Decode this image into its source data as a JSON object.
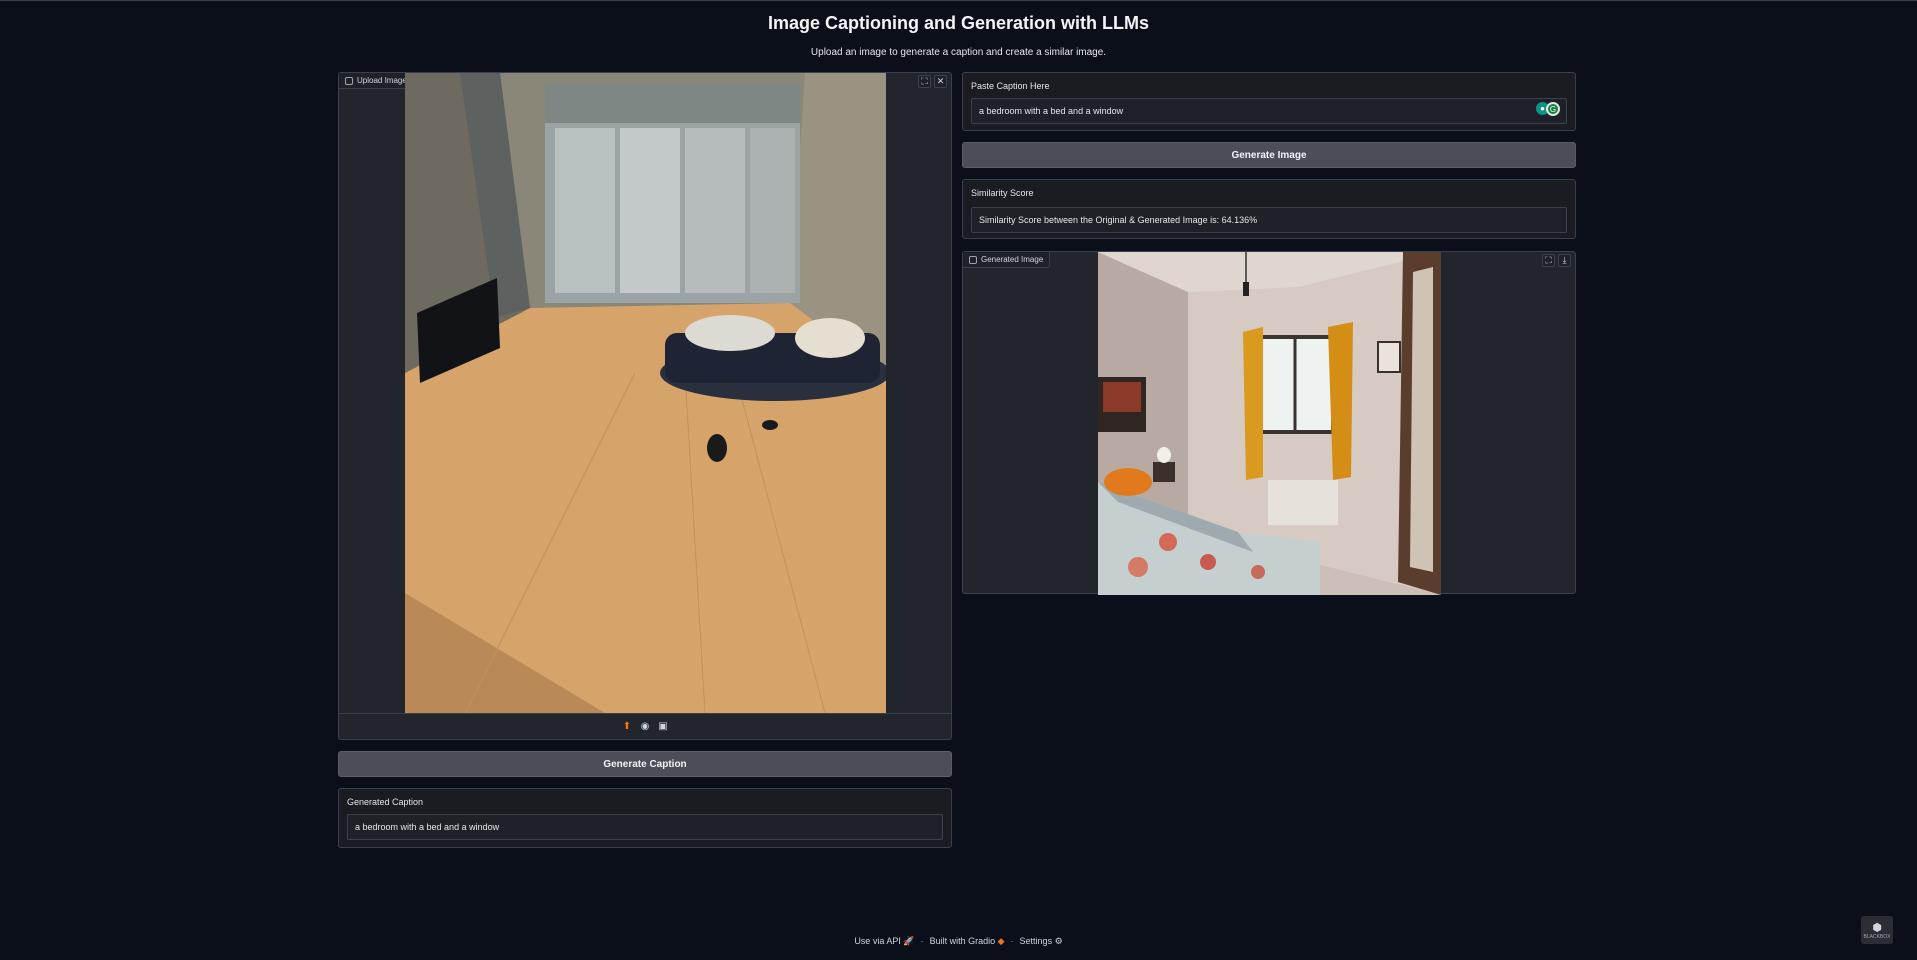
{
  "header": {
    "title": "Image Captioning and Generation with LLMs",
    "subtitle": "Upload an image to generate a caption and create a similar image."
  },
  "upload_panel": {
    "label": "Upload Image",
    "image_alt": "photo of a room with a wooden floor, an inflatable mattress, a TV and a window with blinds",
    "toolbar_icons": [
      "upload-icon",
      "webcam-icon",
      "clipboard-icon"
    ]
  },
  "generate_caption_button": "Generate Caption",
  "generated_caption": {
    "label": "Generated Caption",
    "value": "a bedroom with a bed and a window"
  },
  "caption_input": {
    "label": "Paste Caption Here",
    "value": "a bedroom with a bed and a window"
  },
  "generate_image_button": "Generate Image",
  "similarity": {
    "label": "Similarity Score",
    "value": "Similarity Score between the Original & Generated Image is: 64.136%"
  },
  "generated_image": {
    "label": "Generated Image",
    "image_alt": "bedroom with a bed with floral bedding, orange pillow, window with orange curtains"
  },
  "footer": {
    "api": "Use via API",
    "built": "Built with Gradio",
    "settings": "Settings",
    "sep": "·"
  },
  "corner_logo": "BLACKBOX",
  "colors": {
    "background": "#0b0f19",
    "button": "#4b4d57",
    "accent": "#f97316"
  }
}
